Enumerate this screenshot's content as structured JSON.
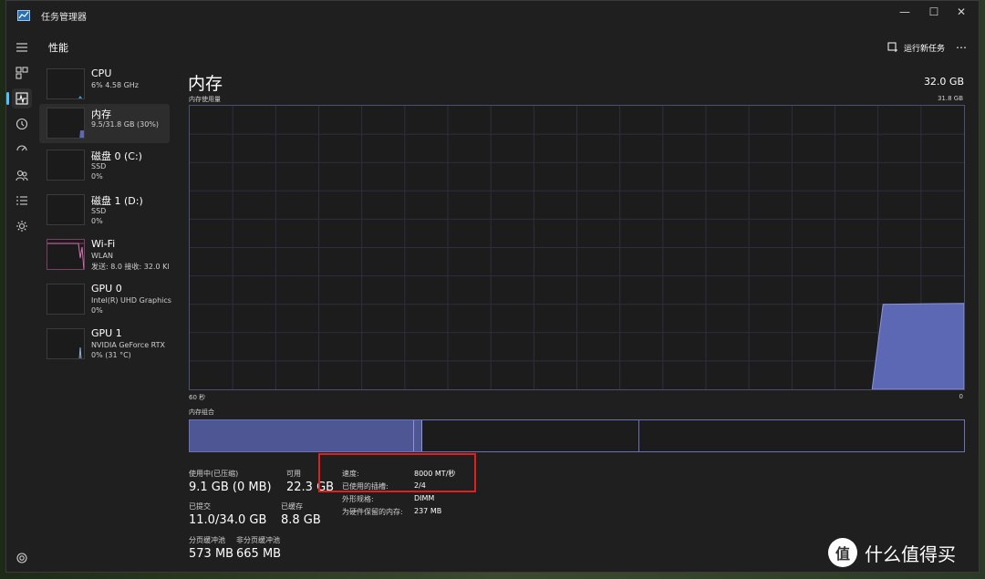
{
  "window": {
    "title": "任务管理器",
    "controls": {
      "minimize": "—",
      "maximize": "☐",
      "close": "✕"
    }
  },
  "header": {
    "section": "性能",
    "run_task": "运行新任务",
    "more": "⋯"
  },
  "rail": {
    "items": [
      "hamburger-icon",
      "processes-icon",
      "performance-icon",
      "app-history-icon",
      "startup-icon",
      "users-icon",
      "details-icon",
      "services-icon"
    ],
    "active": "performance-icon",
    "settings": "settings-icon"
  },
  "devices": [
    {
      "name": "CPU",
      "sub1": "6% 4.58 GHz",
      "sub2": ""
    },
    {
      "name": "内存",
      "sub1": "9.5/31.8 GB (30%)",
      "sub2": ""
    },
    {
      "name": "磁盘 0 (C:)",
      "sub1": "SSD",
      "sub2": "0%"
    },
    {
      "name": "磁盘 1 (D:)",
      "sub1": "SSD",
      "sub2": "0%"
    },
    {
      "name": "Wi-Fi",
      "sub1": "WLAN",
      "sub2": "发送: 8.0 接收: 32.0 Kl"
    },
    {
      "name": "GPU 0",
      "sub1": "Intel(R) UHD Graphics",
      "sub2": "0%"
    },
    {
      "name": "GPU 1",
      "sub1": "NVIDIA GeForce RTX",
      "sub2": "0% (31 °C)"
    }
  ],
  "memory": {
    "title": "内存",
    "total": "32.0 GB",
    "usage_label": "内存使用量",
    "max_label": "31.8 GB",
    "axis_left": "60 秒",
    "axis_right": "0",
    "composition_label": "内存组合",
    "composition": {
      "in_use_fraction": 0.29,
      "modified_fraction": 0.01,
      "standby_fraction": 0.28
    },
    "usage_history_percent": {
      "recent_level": 0.3
    },
    "stats": {
      "in_use_label": "使用中(已压缩)",
      "in_use": "9.1 GB (0 MB)",
      "available_label": "可用",
      "available": "22.3 GB",
      "committed_label": "已提交",
      "committed": "11.0/34.0 GB",
      "cached_label": "已缓存",
      "cached": "8.8 GB",
      "paged_label": "分页缓冲池",
      "paged": "573 MB",
      "nonpaged_label": "非分页缓冲池",
      "nonpaged": "665 MB"
    },
    "specs": {
      "speed_label": "速度:",
      "speed": "8000 MT/秒",
      "slots_label": "已使用的插槽:",
      "slots": "2/4",
      "form_label": "外形规格:",
      "form": "DIMM",
      "reserved_label": "为硬件保留的内存:",
      "reserved": "237 MB"
    }
  },
  "colors": {
    "accent": "#4cc2ff",
    "memory_fill": "#5d68b5",
    "memory_border": "#6b73b8",
    "highlight": "#e02020",
    "wifi_line": "#d873b4"
  },
  "watermark": {
    "text": "什么值得买",
    "logo_glyph": "值"
  }
}
